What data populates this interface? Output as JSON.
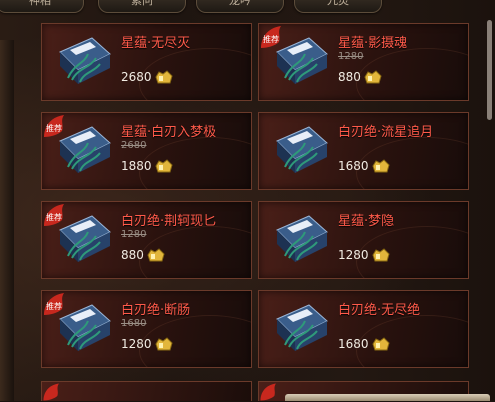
{
  "tabs": [
    {
      "label": "神相"
    },
    {
      "label": "素问"
    },
    {
      "label": "龙吟"
    },
    {
      "label": "九灵"
    }
  ],
  "items": [
    {
      "title": "星蕴·无尽灭",
      "old_price": "",
      "price": "2680",
      "recommended": false
    },
    {
      "title": "星蕴·影摄魂",
      "old_price": "1280",
      "price": "880",
      "recommended": true
    },
    {
      "title": "星蕴·白刃入梦极",
      "old_price": "2680",
      "price": "1880",
      "recommended": true
    },
    {
      "title": "白刃绝·流星追月",
      "old_price": "",
      "price": "1680",
      "recommended": false
    },
    {
      "title": "白刃绝·荆轲现匕",
      "old_price": "1280",
      "price": "880",
      "recommended": true
    },
    {
      "title": "星蕴·梦隐",
      "old_price": "",
      "price": "1280",
      "recommended": false
    },
    {
      "title": "白刃绝·断肠",
      "old_price": "1680",
      "price": "1280",
      "recommended": true
    },
    {
      "title": "白刃绝·无尽绝",
      "old_price": "",
      "price": "1680",
      "recommended": false
    }
  ],
  "badge_text": "推荐",
  "icons": {
    "book": "skill-book-icon",
    "currency": "gold-ingot-icon"
  },
  "colors": {
    "title": "#ff5a4a",
    "badge": "#c8281e"
  }
}
